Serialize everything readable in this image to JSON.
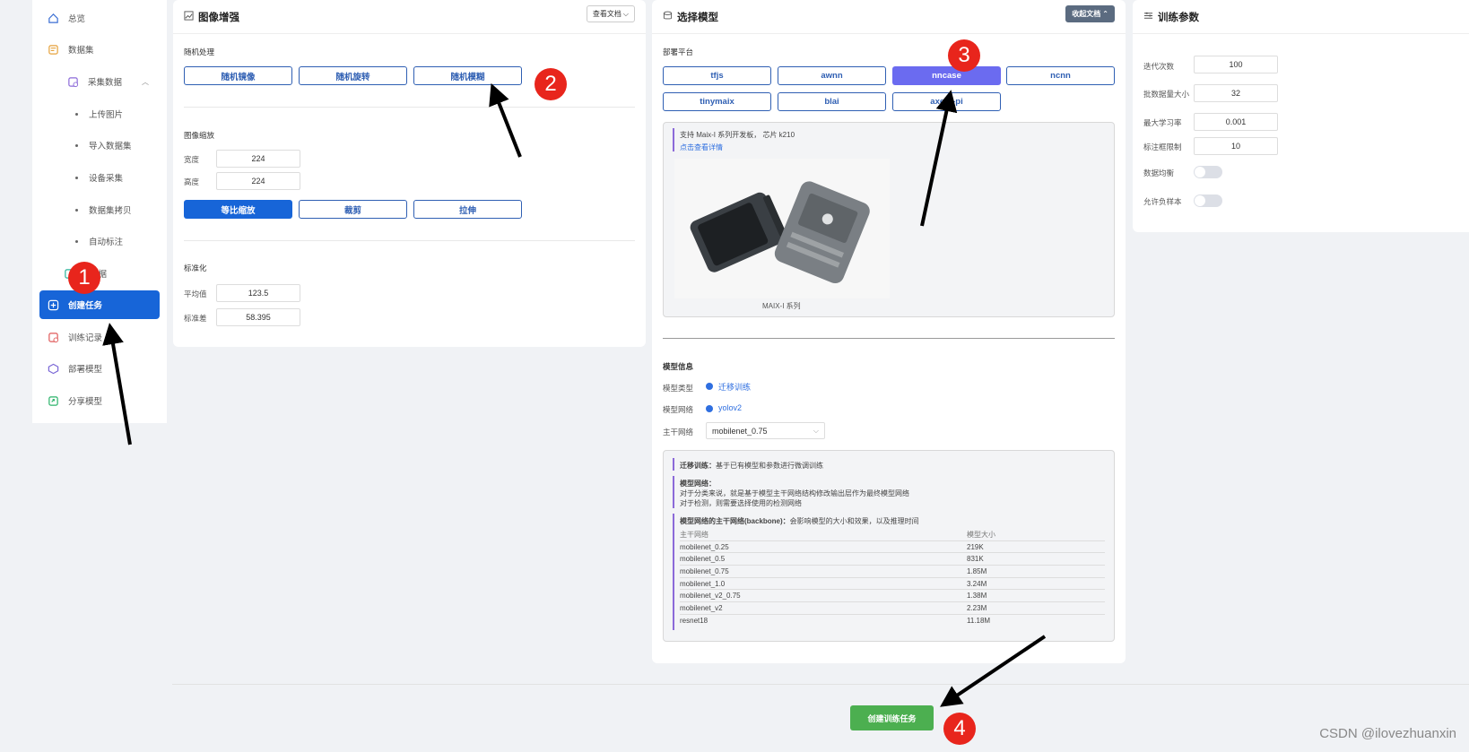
{
  "sidebar": {
    "items": [
      {
        "label": "总览",
        "icon": "home-icon"
      },
      {
        "label": "数据集",
        "icon": "dataset-icon"
      },
      {
        "label": "采集数据",
        "icon": "collect-icon"
      },
      {
        "label": "上传图片"
      },
      {
        "label": "导入数据集"
      },
      {
        "label": "设备采集"
      },
      {
        "label": "数据集拷贝"
      },
      {
        "label": "自动标注"
      },
      {
        "label": "数据",
        "icon": "data-icon"
      },
      {
        "label": "创建任务",
        "icon": "plus-icon"
      },
      {
        "label": "训练记录",
        "icon": "record-icon"
      },
      {
        "label": "部署模型",
        "icon": "deploy-icon"
      },
      {
        "label": "分享模型",
        "icon": "share-icon"
      }
    ]
  },
  "augment": {
    "title": "图像增强",
    "doc_button": "查看文档",
    "random_label": "随机处理",
    "random_buttons": [
      "随机镜像",
      "随机旋转",
      "随机模糊"
    ],
    "scale_label": "图像缩放",
    "width_label": "宽度",
    "width_value": "224",
    "height_label": "高度",
    "height_value": "224",
    "scale_buttons": [
      "等比缩放",
      "裁剪",
      "拉伸"
    ],
    "norm_label": "标准化",
    "mean_label": "平均值",
    "mean_value": "123.5",
    "std_label": "标准差",
    "std_value": "58.395"
  },
  "model": {
    "title": "选择模型",
    "collapse_button": "收起文档",
    "platform_label": "部署平台",
    "platforms": [
      "tfjs",
      "awnn",
      "nncase",
      "ncnn",
      "tinymaix",
      "blai",
      "axera-pi"
    ],
    "selected_platform": "nncase",
    "platform_desc": "支持 Maix-I 系列开发板， 芯片 k210",
    "platform_link": "点击查看详情",
    "image_caption": "MAIX-I 系列",
    "info_label": "模型信息",
    "type_label": "模型类型",
    "type_value": "迁移训练",
    "network_label": "模型网络",
    "network_value": "yolov2",
    "backbone_label": "主干网络",
    "backbone_value": "mobilenet_0.75",
    "doc": {
      "transfer_title": "迁移训练：",
      "transfer_text": "基于已有模型和参数进行微调训练",
      "network_title": "模型网络：",
      "network_line1": "对于分类来说，就是基于模型主干网络结构修改输出层作为最终模型网络",
      "network_line2": "对于检测，则需要选择使用的检测网络",
      "backbone_title": "模型网络的主干网络(backbone)：",
      "backbone_text": "会影响模型的大小和效果，以及推理时间",
      "table_head": [
        "主干网络",
        "模型大小"
      ],
      "table_rows": [
        [
          "mobilenet_0.25",
          "219K"
        ],
        [
          "mobilenet_0.5",
          "831K"
        ],
        [
          "mobilenet_0.75",
          "1.85M"
        ],
        [
          "mobilenet_1.0",
          "3.24M"
        ],
        [
          "mobilenet_v2_0.75",
          "1.38M"
        ],
        [
          "mobilenet_v2",
          "2.23M"
        ],
        [
          "resnet18",
          "11.18M"
        ]
      ]
    }
  },
  "train": {
    "title": "训练参数",
    "epochs_label": "迭代次数",
    "epochs_value": "100",
    "batch_label": "批数据量大小",
    "batch_value": "32",
    "lr_label": "最大学习率",
    "lr_value": "0.001",
    "limit_label": "标注框限制",
    "limit_value": "10",
    "balance_label": "数据均衡",
    "negative_label": "允许负样本"
  },
  "create_button": "创建训练任务",
  "annotations": [
    "1",
    "2",
    "3",
    "4"
  ],
  "watermark": "CSDN @ilovezhuanxin",
  "colors": {
    "primary": "#1765d8",
    "selected_platform": "#6b6bf0",
    "create": "#4caf50",
    "badge": "#e8251c"
  }
}
